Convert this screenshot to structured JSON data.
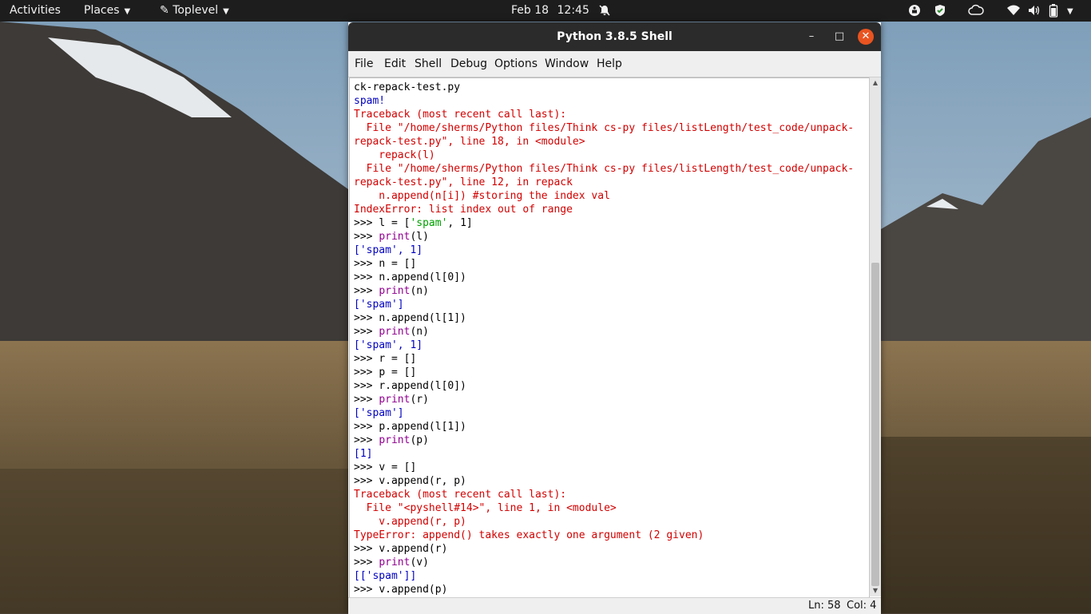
{
  "topbar": {
    "activities": "Activities",
    "places": "Places",
    "app_menu": "Toplevel",
    "date": "Feb 18",
    "time": "12:45",
    "tray_icons": [
      "notifications-off-icon",
      "accessibility-icon",
      "shield-icon",
      "cloud-icon",
      "wifi-icon",
      "volume-icon",
      "battery-icon"
    ]
  },
  "window": {
    "title": "Python 3.8.5 Shell",
    "controls": {
      "minimize": "–",
      "maximize": "□",
      "close": "✕"
    }
  },
  "menu": [
    "File",
    "Edit",
    "Shell",
    "Debug",
    "Options",
    "Window",
    "Help"
  ],
  "shell_lines": [
    [
      {
        "t": "ck-repack-test.py",
        "c": "def"
      }
    ],
    [
      {
        "t": "spam!",
        "c": "out"
      }
    ],
    [
      {
        "t": "Traceback (most recent call last):",
        "c": "err"
      }
    ],
    [
      {
        "t": "  File \"/home/sherms/Python files/Think cs-py files/listLength/test_code/unpack-",
        "c": "err"
      }
    ],
    [
      {
        "t": "repack-test.py\", line 18, in <module>",
        "c": "err"
      }
    ],
    [
      {
        "t": "    repack(l)",
        "c": "err"
      }
    ],
    [
      {
        "t": "  File \"/home/sherms/Python files/Think cs-py files/listLength/test_code/unpack-",
        "c": "err"
      }
    ],
    [
      {
        "t": "repack-test.py\", line 12, in repack",
        "c": "err"
      }
    ],
    [
      {
        "t": "    n.append(n[i]) #storing the index val",
        "c": "err"
      }
    ],
    [
      {
        "t": "IndexError: list index out of range",
        "c": "err"
      }
    ],
    [
      {
        "t": ">>> ",
        "c": "prompt"
      },
      {
        "t": "l = [",
        "c": "def"
      },
      {
        "t": "'spam'",
        "c": "str"
      },
      {
        "t": ", 1]",
        "c": "def"
      }
    ],
    [
      {
        "t": ">>> ",
        "c": "prompt"
      },
      {
        "t": "print",
        "c": "builtin"
      },
      {
        "t": "(l)",
        "c": "def"
      }
    ],
    [
      {
        "t": "['spam', 1]",
        "c": "out"
      }
    ],
    [
      {
        "t": ">>> ",
        "c": "prompt"
      },
      {
        "t": "n = []",
        "c": "def"
      }
    ],
    [
      {
        "t": ">>> ",
        "c": "prompt"
      },
      {
        "t": "n.append(l[0])",
        "c": "def"
      }
    ],
    [
      {
        "t": ">>> ",
        "c": "prompt"
      },
      {
        "t": "print",
        "c": "builtin"
      },
      {
        "t": "(n)",
        "c": "def"
      }
    ],
    [
      {
        "t": "['spam']",
        "c": "out"
      }
    ],
    [
      {
        "t": ">>> ",
        "c": "prompt"
      },
      {
        "t": "n.append(l[1])",
        "c": "def"
      }
    ],
    [
      {
        "t": ">>> ",
        "c": "prompt"
      },
      {
        "t": "print",
        "c": "builtin"
      },
      {
        "t": "(n)",
        "c": "def"
      }
    ],
    [
      {
        "t": "['spam', 1]",
        "c": "out"
      }
    ],
    [
      {
        "t": ">>> ",
        "c": "prompt"
      },
      {
        "t": "r = []",
        "c": "def"
      }
    ],
    [
      {
        "t": ">>> ",
        "c": "prompt"
      },
      {
        "t": "p = []",
        "c": "def"
      }
    ],
    [
      {
        "t": ">>> ",
        "c": "prompt"
      },
      {
        "t": "r.append(l[0])",
        "c": "def"
      }
    ],
    [
      {
        "t": ">>> ",
        "c": "prompt"
      },
      {
        "t": "print",
        "c": "builtin"
      },
      {
        "t": "(r)",
        "c": "def"
      }
    ],
    [
      {
        "t": "['spam']",
        "c": "out"
      }
    ],
    [
      {
        "t": ">>> ",
        "c": "prompt"
      },
      {
        "t": "p.append(l[1])",
        "c": "def"
      }
    ],
    [
      {
        "t": ">>> ",
        "c": "prompt"
      },
      {
        "t": "print",
        "c": "builtin"
      },
      {
        "t": "(p)",
        "c": "def"
      }
    ],
    [
      {
        "t": "[1]",
        "c": "out"
      }
    ],
    [
      {
        "t": ">>> ",
        "c": "prompt"
      },
      {
        "t": "v = []",
        "c": "def"
      }
    ],
    [
      {
        "t": ">>> ",
        "c": "prompt"
      },
      {
        "t": "v.append(r, p)",
        "c": "def"
      }
    ],
    [
      {
        "t": "Traceback (most recent call last):",
        "c": "err"
      }
    ],
    [
      {
        "t": "  File \"<pyshell#14>\", line 1, in <module>",
        "c": "err"
      }
    ],
    [
      {
        "t": "    v.append(r, p)",
        "c": "err"
      }
    ],
    [
      {
        "t": "TypeError: append() takes exactly one argument (2 given)",
        "c": "err"
      }
    ],
    [
      {
        "t": ">>> ",
        "c": "prompt"
      },
      {
        "t": "v.append(r)",
        "c": "def"
      }
    ],
    [
      {
        "t": ">>> ",
        "c": "prompt"
      },
      {
        "t": "print",
        "c": "builtin"
      },
      {
        "t": "(v)",
        "c": "def"
      }
    ],
    [
      {
        "t": "[['spam']]",
        "c": "out"
      }
    ],
    [
      {
        "t": ">>> ",
        "c": "prompt"
      },
      {
        "t": "v.append(p)",
        "c": "def"
      }
    ]
  ],
  "status": {
    "line": "Ln: 58",
    "col": "Col: 4"
  },
  "colors": {
    "output": "#0000c0",
    "error": "#d20000",
    "builtin": "#900090",
    "string": "#00a000",
    "accent": "#e95420"
  }
}
